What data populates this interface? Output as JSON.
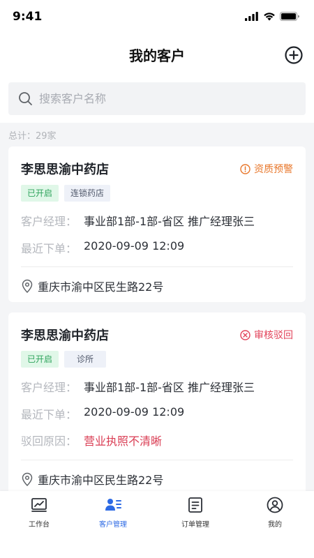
{
  "status_bar": {
    "time": "9:41"
  },
  "header": {
    "title": "我的客户"
  },
  "search": {
    "placeholder": "搜索客户名称"
  },
  "total_text": "总计：29家",
  "customers": [
    {
      "name": "李思思渝中药店",
      "status": {
        "label": "资质预警",
        "color": "#e8772b",
        "icon": "alert-circle-icon"
      },
      "tags": [
        "已开启",
        "连锁药店"
      ],
      "manager_label": "客户经理：",
      "manager_value": "事业部1部-1部-省区  推广经理张三",
      "last_order_label": "最近下单：",
      "last_order_value": "2020-09-09 12:09",
      "address": "重庆市渝中区民生路22号"
    },
    {
      "name": "李思思渝中药店",
      "status": {
        "label": "审核驳回",
        "color": "#e2435a",
        "icon": "x-circle-icon"
      },
      "tags": [
        "已开启",
        "诊所"
      ],
      "manager_label": "客户经理：",
      "manager_value": "事业部1部-1部-省区  推广经理张三",
      "last_order_label": "最近下单：",
      "last_order_value": "2020-09-09 12:09",
      "reject_label": "驳回原因：",
      "reject_value": "营业执照不清晰",
      "address": "重庆市渝中区民生路22号"
    }
  ],
  "tabbar": {
    "active_color": "#2d6ae4",
    "items": [
      {
        "label": "工作台",
        "icon": "chart-monitor-icon"
      },
      {
        "label": "客户管理",
        "icon": "customers-icon",
        "active": true
      },
      {
        "label": "订单管理",
        "icon": "document-icon"
      },
      {
        "label": "我的",
        "icon": "user-circle-icon"
      }
    ]
  }
}
